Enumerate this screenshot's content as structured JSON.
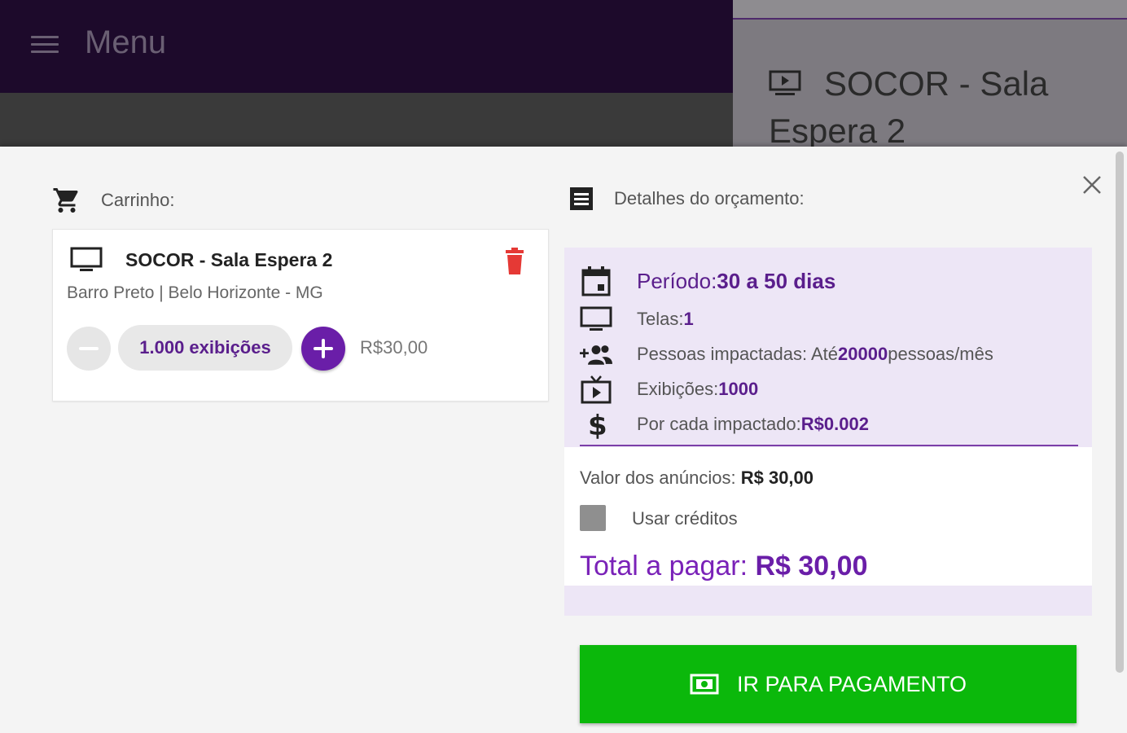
{
  "background": {
    "menu_label": "Menu",
    "right_title": "SOCOR - Sala Espera 2"
  },
  "cart": {
    "heading": "Carrinho:",
    "item": {
      "title": "SOCOR - Sala Espera 2",
      "location": "Barro Preto | Belo Horizonte - MG",
      "quantity": "1.000 exibições",
      "price": "R$30,00"
    }
  },
  "details": {
    "heading": "Detalhes do orçamento:",
    "periodo_label": "Período: ",
    "periodo_value": "30 a 50 dias",
    "telas_label": "Telas: ",
    "telas_value": "1",
    "pessoas_label": "Pessoas impactadas: Até ",
    "pessoas_value": "20000",
    "pessoas_suffix": " pessoas/mês",
    "exibicoes_label": "Exibições: ",
    "exibicoes_value": "1000",
    "por_cada_label": "Por cada impactado: ",
    "por_cada_value": "R$0.002",
    "valor_label": "Valor dos anúncios: ",
    "valor_value": "R$ 30,00",
    "usar_creditos": "Usar créditos",
    "total_label": "Total a pagar: ",
    "total_value": "R$ 30,00"
  },
  "pay_button": "IR PARA PAGAMENTO",
  "colors": {
    "accent": "#6a1ea8",
    "pay": "#0bb80b",
    "delete": "#e53935",
    "details_bg": "#ede6f6"
  }
}
